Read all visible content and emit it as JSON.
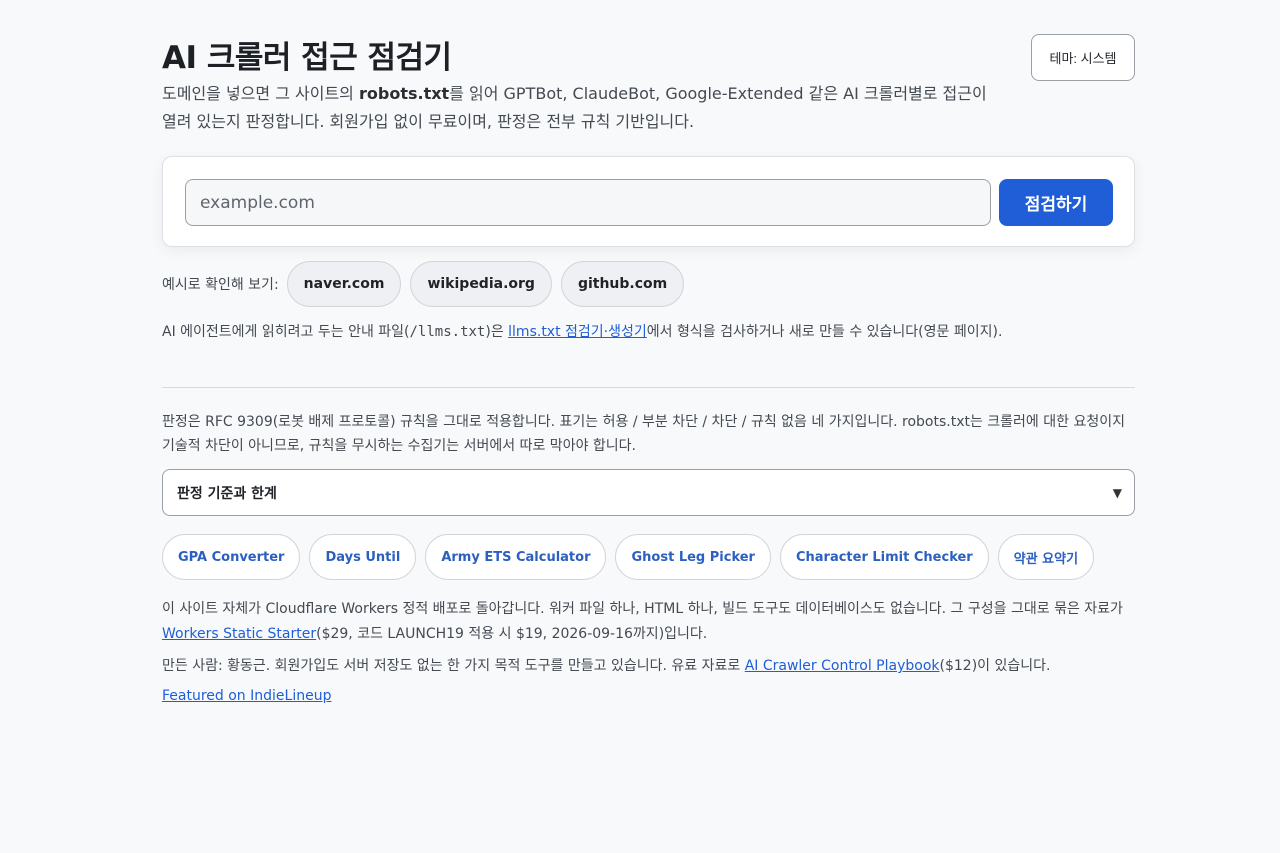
{
  "header": {
    "title": "AI 크롤러 접근 점검기",
    "theme_button": "테마: 시스템",
    "desc_before": "도메인을 넣으면 그 사이트의 ",
    "desc_bold": "robots.txt",
    "desc_after": "를 읽어 GPTBot, ClaudeBot, Google-Extended 같은 AI 크롤러별로 접근이 열려 있는지 판정합니다. 회원가입 없이 무료이며, 판정은 전부 규칙 기반입니다."
  },
  "search": {
    "placeholder": "example.com",
    "value": "",
    "submit_label": "점검하기"
  },
  "examples": {
    "label": "예시로 확인해 보기:",
    "items": [
      "naver.com",
      "wikipedia.org",
      "github.com"
    ]
  },
  "llms": {
    "before": "AI 에이전트에게 읽히려고 두는 안내 파일(",
    "code": "/llms.txt",
    "middle": ")은 ",
    "link": "llms.txt 점검기·생성기",
    "after": "에서 형식을 검사하거나 새로 만들 수 있습니다(영문 페이지)."
  },
  "rules": {
    "text": "판정은 RFC 9309(로봇 배제 프로토콜) 규칙을 그대로 적용합니다. 표기는 허용 / 부분 차단 / 차단 / 규칙 없음 네 가지입니다. robots.txt는 크롤러에 대한 요청이지 기술적 차단이 아니므로, 규칙을 무시하는 수집기는 서버에서 따로 막아야 합니다.",
    "details_label": "판정 기준과 한계",
    "caret": "▼"
  },
  "tools": [
    "GPA Converter",
    "Days Until",
    "Army ETS Calculator",
    "Ghost Leg Picker",
    "Character Limit Checker",
    "약관 요약기"
  ],
  "footer": {
    "line1_before": "이 사이트 자체가 Cloudflare Workers 정적 배포로 돌아갑니다. 워커 파일 하나, HTML 하나, 빌드 도구도 데이터베이스도 없습니다. 그 구성을 그대로 묶은 자료가 ",
    "line1_link": "Workers Static Starter",
    "line1_after": "($29, 코드 LAUNCH19 적용 시 $19, 2026-09-16까지)입니다.",
    "line2_before": "만든 사람: 황동근. 회원가입도 서버 저장도 없는 한 가지 목적 도구를 만들고 있습니다. 유료 자료로 ",
    "line2_link": "AI Crawler Control Playbook",
    "line2_after": "($12)이 있습니다.",
    "featured": "Featured on IndieLineup"
  }
}
